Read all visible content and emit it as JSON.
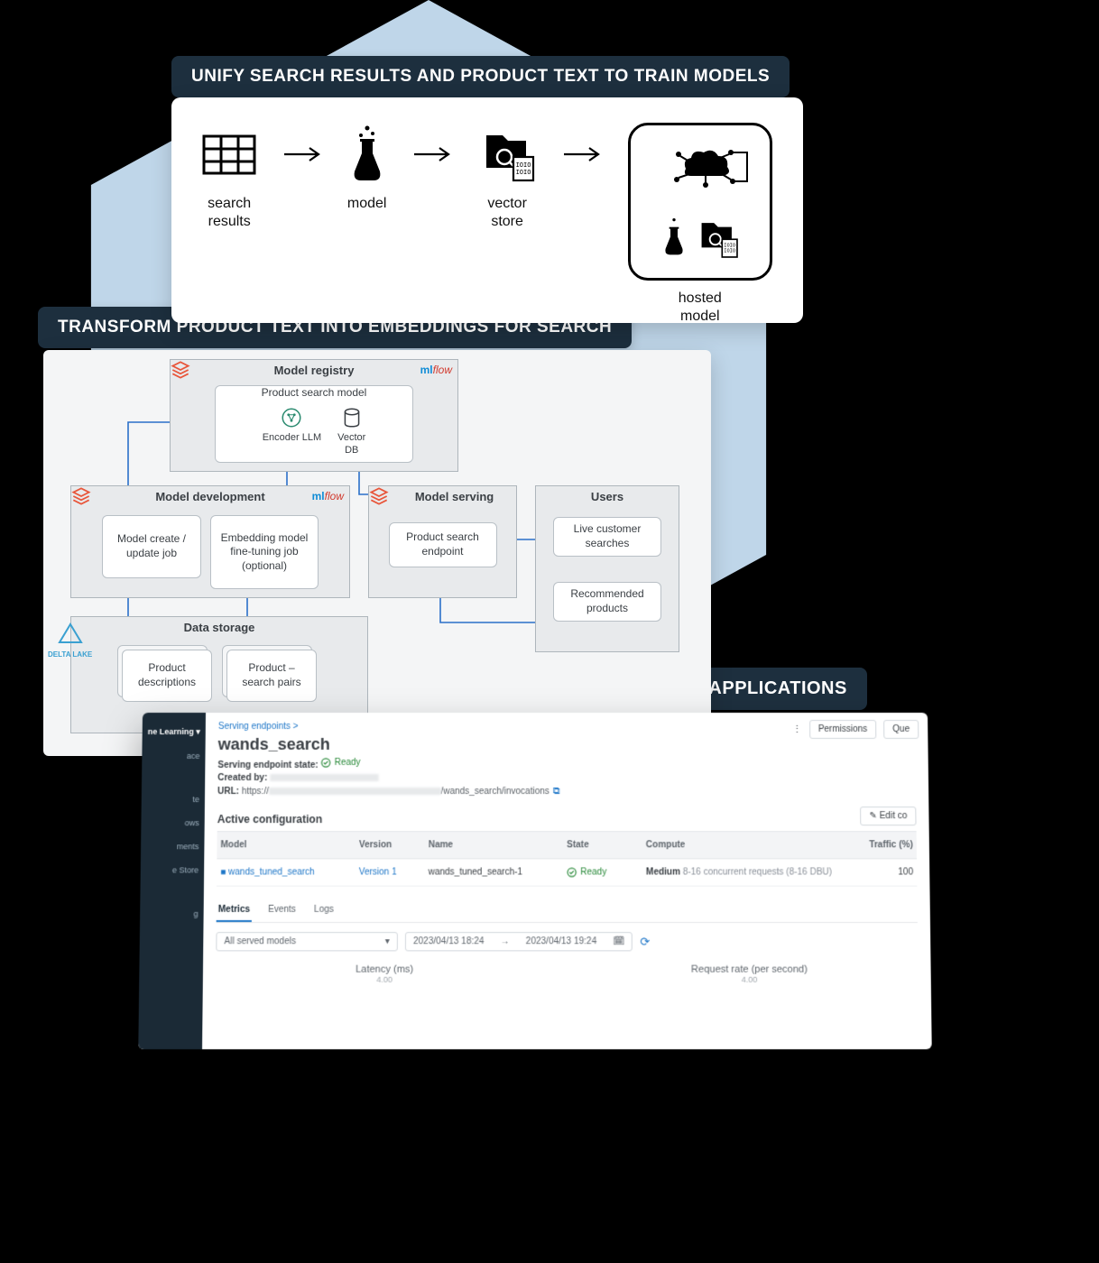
{
  "banners": {
    "b1": "UNIFY SEARCH RESULTS AND PRODUCT TEXT TO TRAIN MODELS",
    "b2": "TRANSFORM PRODUCT TEXT INTO EMBEDDINGS FOR SEARCH",
    "b3": "DEPLOY MODEL AS MICROSERVICE TO INTEGRATE INTO APPLICATIONS"
  },
  "pipeline": {
    "items": {
      "search_results": "search\nresults",
      "model": "model",
      "vector_store": "vector\nstore",
      "hosted_model": "hosted\nmodel"
    }
  },
  "arch": {
    "registry": {
      "title": "Model registry",
      "subtitle": "Product search model",
      "encoder": "Encoder LLM",
      "vectordb": "Vector\nDB"
    },
    "dev": {
      "title": "Model development",
      "create_job": "Model create /\nupdate job",
      "finetune_job": "Embedding\nmodel\nfine-tuning job\n(optional)"
    },
    "serve": {
      "title": "Model serving",
      "endpoint": "Product search\nendpoint"
    },
    "users": {
      "title": "Users",
      "live": "Live customer\nsearches",
      "recommended": "Recommended\nproducts"
    },
    "storage": {
      "title": "Data storage",
      "product": "Product\ndescriptions",
      "pairs": "Product –\nsearch pairs"
    },
    "delta": "DELTA LAKE"
  },
  "dash": {
    "sidebar": {
      "top": "ne Learning ▾",
      "items": [
        "ace",
        "te",
        "ows",
        "ments",
        "e Store",
        "g"
      ]
    },
    "crumb": "Serving endpoints  >",
    "title": "wands_search",
    "state_label": "Serving endpoint state:",
    "state_value": "Ready",
    "created_label": "Created by:",
    "url_label": "URL:",
    "url_prefix": "https://",
    "url_suffix": "/wands_search/invocations",
    "actions": {
      "permissions": "Permissions",
      "query": "Que",
      "edit": "✎  Edit co"
    },
    "config_title": "Active configuration",
    "cols": {
      "model": "Model",
      "version": "Version",
      "name": "Name",
      "state": "State",
      "compute": "Compute",
      "traffic": "Traffic (%)"
    },
    "row": {
      "model": "wands_tuned_search",
      "version": "Version 1",
      "name": "wands_tuned_search-1",
      "state": "Ready",
      "compute_label": "Medium",
      "compute_detail": "8-16 concurrent requests (8-16 DBU)",
      "traffic": "100"
    },
    "tabs": {
      "metrics": "Metrics",
      "events": "Events",
      "logs": "Logs"
    },
    "filter": {
      "models": "All served models",
      "from": "2023/04/13 18:24",
      "to": "2023/04/13 19:24"
    },
    "charts": {
      "latency": {
        "title": "Latency (ms)",
        "value": "4.00"
      },
      "req_rate": {
        "title": "Request rate (per second)",
        "value": "4.00"
      }
    }
  },
  "mlflow": {
    "ml": "ml",
    "flow": "flow"
  }
}
